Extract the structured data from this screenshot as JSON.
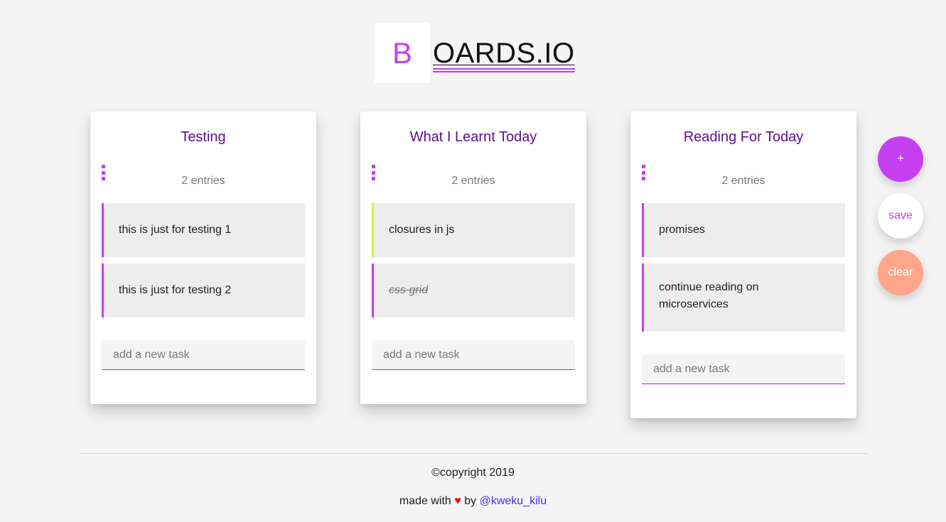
{
  "logo": {
    "letter": "B",
    "rest": "OARDS.IO"
  },
  "boards": [
    {
      "title": "Testing",
      "entries": "2 entries",
      "tasks": [
        {
          "text": "this is just for testing 1"
        },
        {
          "text": "this is just for testing 2"
        }
      ],
      "input_placeholder": "add a new task"
    },
    {
      "title": "What I Learnt Today",
      "entries": "2 entries",
      "tasks": [
        {
          "text": "closures in js"
        },
        {
          "text": "css grid"
        }
      ],
      "input_placeholder": "add a new task"
    },
    {
      "title": "Reading For Today",
      "entries": "2 entries",
      "tasks": [
        {
          "text": "promises"
        },
        {
          "text": "continue reading on microservices"
        }
      ],
      "input_placeholder": "add a new task"
    }
  ],
  "actions": {
    "add": "+",
    "save": "save",
    "clear": "clear"
  },
  "footer": {
    "copyright": "©copyright 2019",
    "made_with": "made with",
    "heart": "♥",
    "by": "by",
    "author": "@kweku_kilu"
  },
  "colors": {
    "accent": "#c53ff0",
    "title": "#5c0f8b",
    "lime": "#d8f03f",
    "clear": "#ffa68a"
  }
}
